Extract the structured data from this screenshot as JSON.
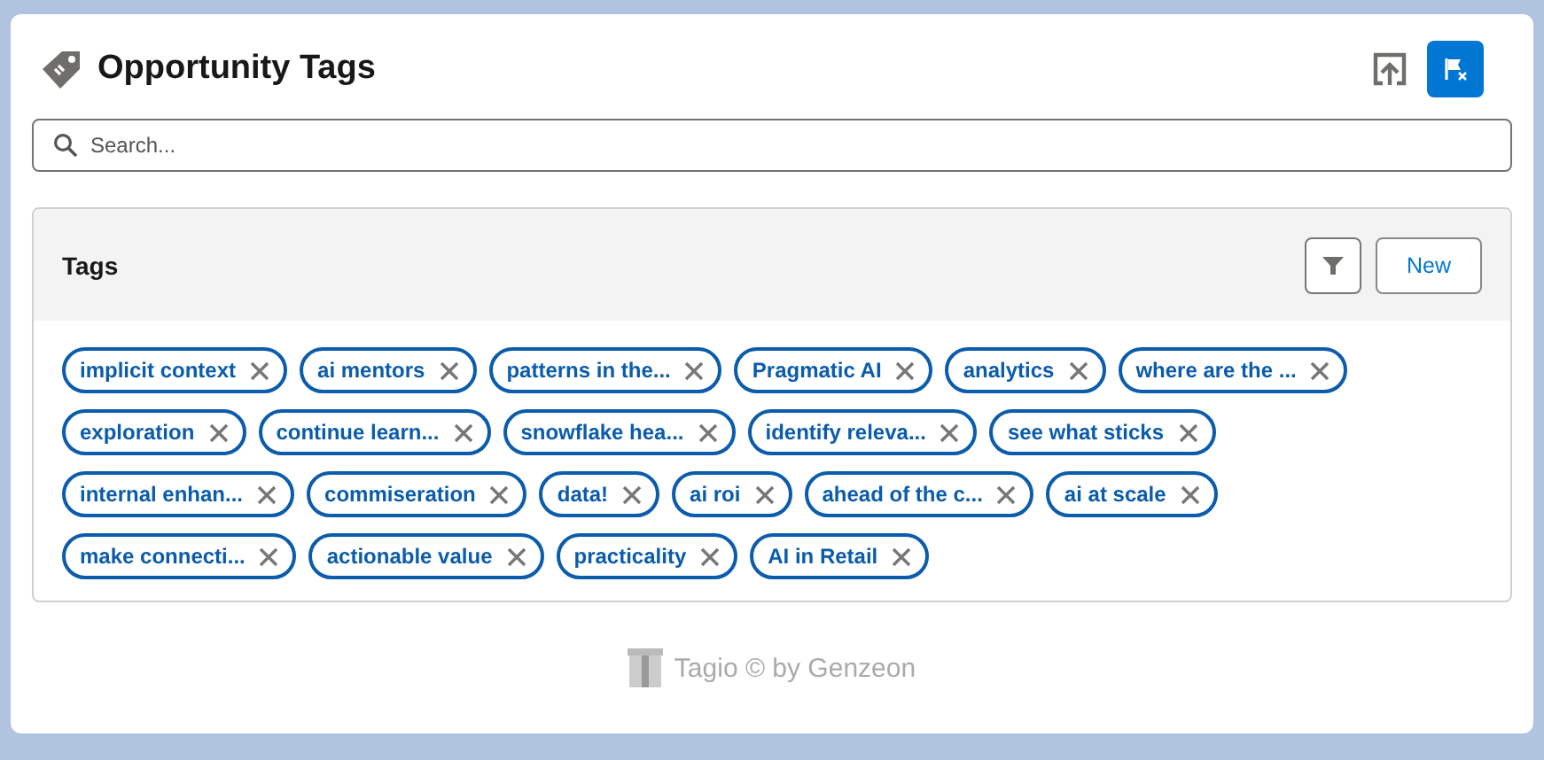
{
  "header": {
    "title": "Opportunity Tags"
  },
  "search": {
    "placeholder": "Search..."
  },
  "tags_panel": {
    "title": "Tags",
    "new_button": "New",
    "rows": [
      [
        "implicit context",
        "ai mentors",
        "patterns in the...",
        "Pragmatic AI",
        "analytics",
        "where are the ..."
      ],
      [
        "exploration",
        "continue learn...",
        "snowflake hea...",
        "identify releva...",
        "see what sticks"
      ],
      [
        "internal enhan...",
        "commiseration",
        "data!",
        "ai roi",
        "ahead of the c...",
        "ai at scale"
      ],
      [
        "make connecti...",
        "actionable value",
        "practicality",
        "AI in Retail"
      ]
    ]
  },
  "footer": {
    "text": "Tagio © by Genzeon"
  }
}
